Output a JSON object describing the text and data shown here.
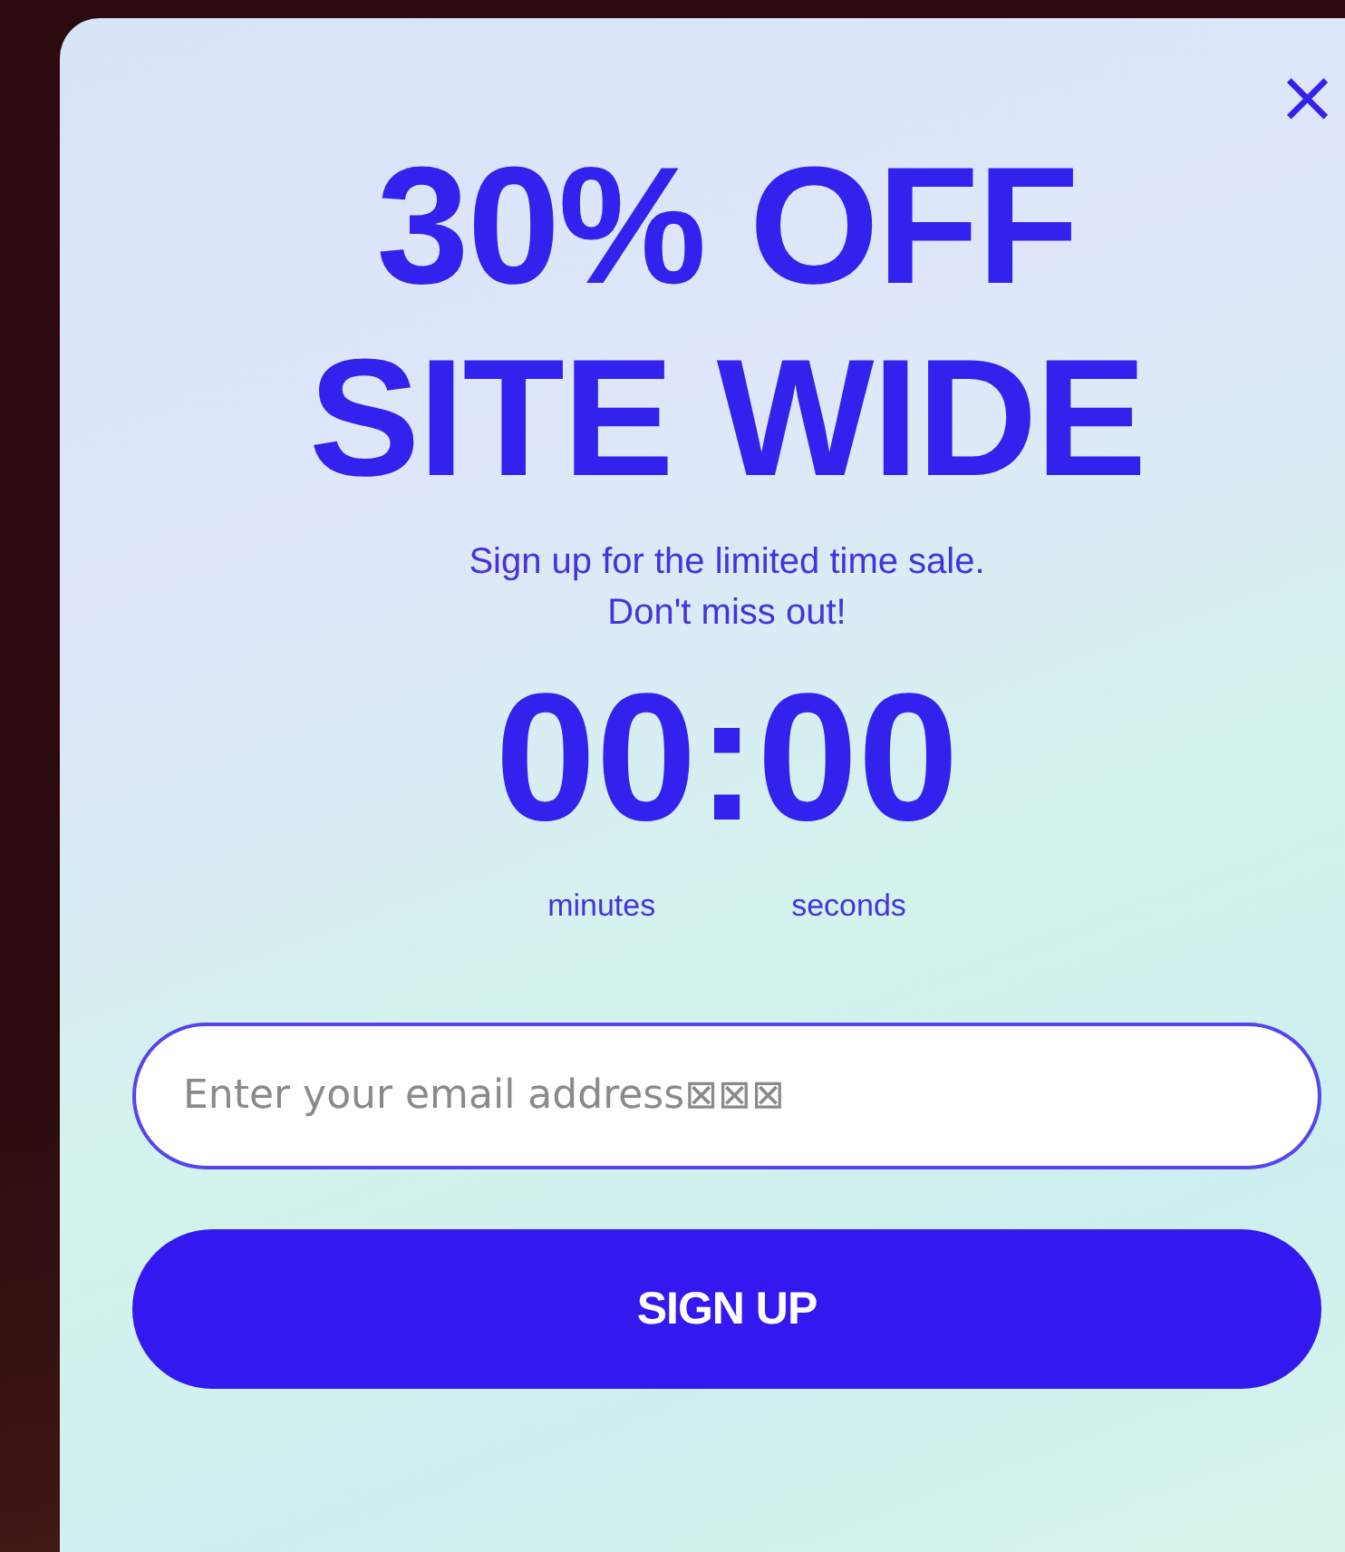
{
  "popup": {
    "close": "×",
    "headline": [
      "30% OFF",
      "SITE WIDE"
    ],
    "subtitle": [
      "Sign up for the limited time sale.",
      "Don't miss out!"
    ],
    "timer": {
      "value": "00:00",
      "units": [
        "minutes",
        "seconds"
      ]
    },
    "email": {
      "placeholder": "Enter your email address⊠⊠⊠"
    },
    "button": "SIGN UP"
  }
}
